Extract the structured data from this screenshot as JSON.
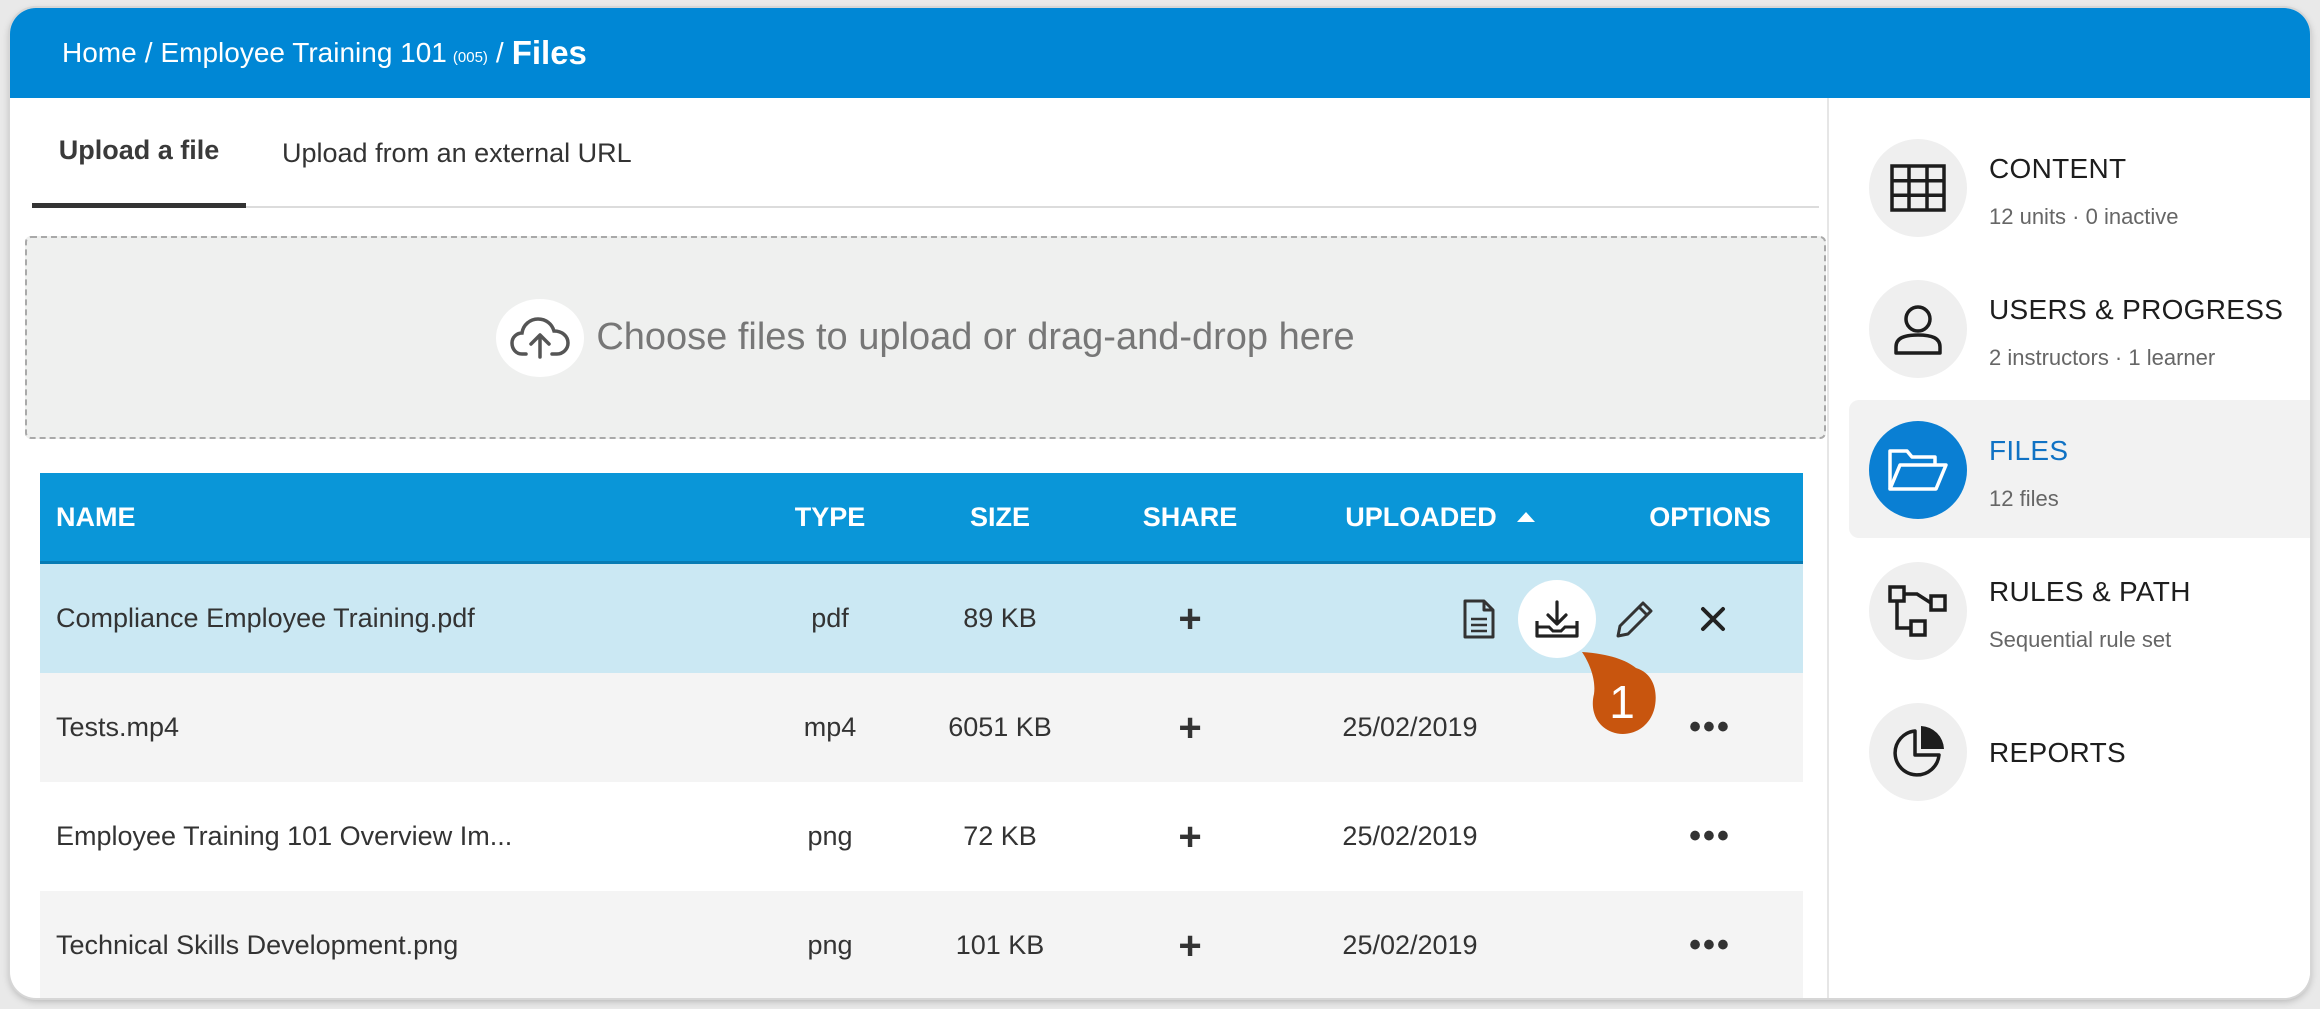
{
  "breadcrumb": {
    "home": "Home",
    "course": "Employee Training 101",
    "course_code": "(005)",
    "current": "Files",
    "separator": "/"
  },
  "tabs": [
    {
      "label": "Upload a file",
      "active": true
    },
    {
      "label": "Upload from an external URL",
      "active": false
    }
  ],
  "dropzone": {
    "text": "Choose files to upload or drag-and-drop here"
  },
  "table": {
    "headers": {
      "name": "NAME",
      "type": "TYPE",
      "size": "SIZE",
      "share": "SHARE",
      "uploaded": "UPLOADED",
      "options": "OPTIONS"
    },
    "rows": [
      {
        "name": "Compliance Employee Training.pdf",
        "type": "pdf",
        "size": "89 KB",
        "share": "+",
        "uploaded": "",
        "selected": true
      },
      {
        "name": "Tests.mp4",
        "type": "mp4",
        "size": "6051 KB",
        "share": "+",
        "uploaded": "25/02/2019",
        "options": "•••"
      },
      {
        "name": "Employee Training 101 Overview Im...",
        "type": "png",
        "size": "72 KB",
        "share": "+",
        "uploaded": "25/02/2019",
        "options": "•••"
      },
      {
        "name": "Technical Skills Development.png",
        "type": "png",
        "size": "101 KB",
        "share": "+",
        "uploaded": "25/02/2019",
        "options": "•••"
      }
    ]
  },
  "callout": {
    "number": "1",
    "color": "#c8550e"
  },
  "sidebar": {
    "items": [
      {
        "title": "CONTENT",
        "subtitle": "12 units · 0 inactive",
        "icon": "grid-icon"
      },
      {
        "title": "USERS & PROGRESS",
        "subtitle": "2 instructors · 1 learner",
        "icon": "user-icon"
      },
      {
        "title": "FILES",
        "subtitle": "12 files",
        "icon": "folder-open-icon",
        "active": true
      },
      {
        "title": "RULES & PATH",
        "subtitle": "Sequential rule set",
        "icon": "flow-icon"
      },
      {
        "title": "REPORTS",
        "subtitle": "",
        "icon": "pie-chart-icon"
      }
    ]
  },
  "colors": {
    "header": "#0087d5",
    "table_header": "#0a96d8",
    "selected_row": "#cbe8f3",
    "active_nav_icon": "#0a7fd3"
  }
}
